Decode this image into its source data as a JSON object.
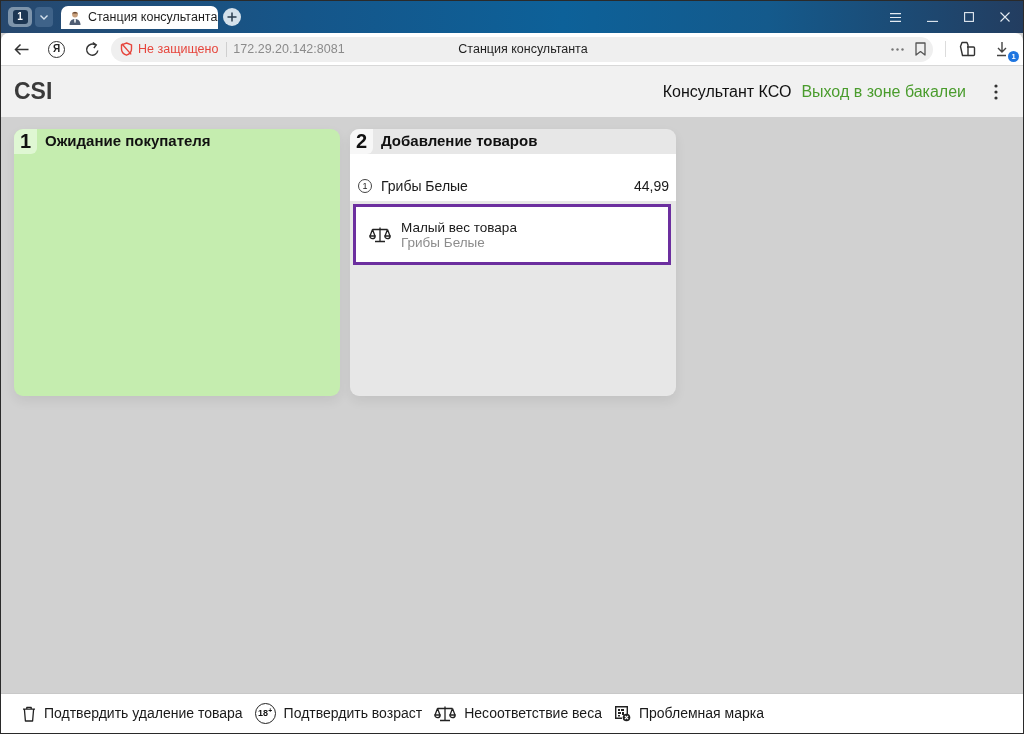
{
  "browser": {
    "workspace": "1",
    "tabs": [
      {
        "title": "Станция консультанта",
        "selected": true
      }
    ],
    "yandex_button": "Я",
    "security": "Не защищено",
    "url": "172.29.20.142:8081",
    "page_title": "Станция консультанта",
    "downloads_badge": "1"
  },
  "app_bar": {
    "logo": "CSI",
    "user": "Консультант КСО",
    "zone": "Выход в зоне бакалеи"
  },
  "stations": [
    {
      "kind": "waiting",
      "number": "1",
      "title": "Ожидание покупателя"
    },
    {
      "kind": "adding",
      "number": "2",
      "title": "Добавление товаров",
      "items": [
        {
          "quantity": "1",
          "name": "Грибы Белые",
          "price": "44,99"
        }
      ],
      "alerts": [
        {
          "kind": "weight",
          "title": "Малый вес товара",
          "product": "Грибы Белые",
          "selected": true
        }
      ]
    }
  ],
  "actions": [
    {
      "kind": "delete",
      "label": "Подтвердить удаление товара"
    },
    {
      "kind": "age",
      "icon_text": "18$^{+}$",
      "label": "Подтвердить возраст"
    },
    {
      "kind": "weight",
      "label": "Несоответствие веса"
    },
    {
      "kind": "mark",
      "label": "Проблемная марка"
    }
  ]
}
